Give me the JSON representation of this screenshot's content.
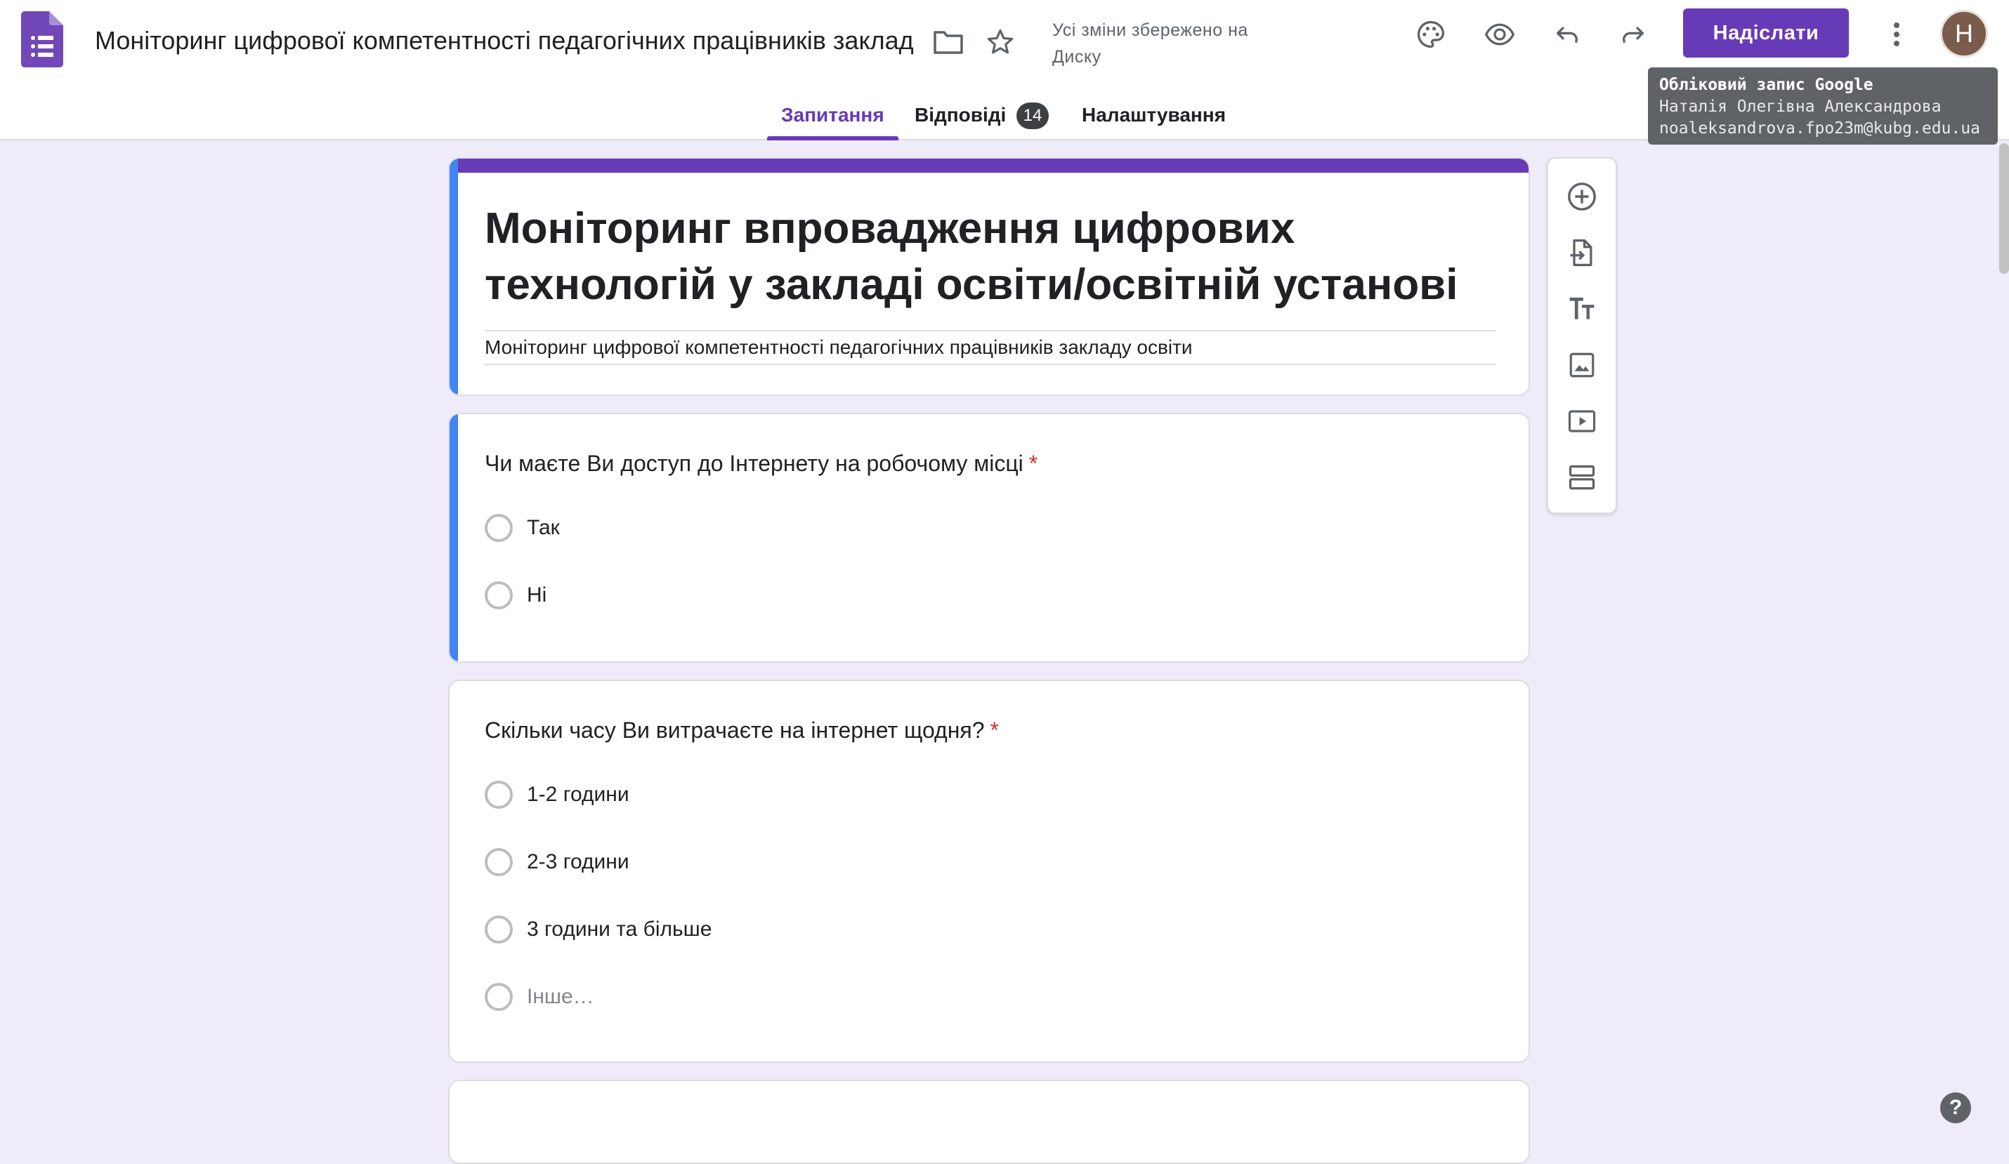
{
  "header": {
    "doc_title": "Моніторинг цифрової компетентності педагогічних працівників заклад",
    "save_status": "Усі зміни збережено на Диску",
    "send_label": "Надіслати",
    "avatar_letter": "Н",
    "icons": [
      "forms-logo-icon",
      "folder-icon",
      "star-icon",
      "palette-icon",
      "preview-eye-icon",
      "undo-icon",
      "redo-icon",
      "more-vert-icon"
    ],
    "accent_color": "#673ab7"
  },
  "tooltip": {
    "line1": "Обліковий запис Google",
    "line2": "Наталія Олегівна Александрова",
    "line3": "noaleksandrova.fpo23m@kubg.edu.ua"
  },
  "tabs": [
    {
      "label": "Запитання",
      "active": true
    },
    {
      "label": "Відповіді",
      "badge": "14"
    },
    {
      "label": "Налаштування"
    }
  ],
  "form": {
    "title": "Моніторинг впровадження цифрових технологій у закладі освіти/освітній установі",
    "description": "Моніторинг цифрової компетентності педагогічних працівників закладу освіти"
  },
  "questions": [
    {
      "text": "Чи маєте Ви доступ до Інтернету на робочому місці",
      "required": "*",
      "options": [
        "Так",
        "Ні"
      ]
    },
    {
      "text": "Скільки часу Ви витрачаєте на інтернет щодня?",
      "required": "*",
      "options": [
        "1-2 години",
        "2-3 години",
        "3 години та більше"
      ],
      "other_option": "Інше…"
    }
  ],
  "sidebar_tools": [
    "add-question-icon",
    "import-questions-icon",
    "add-title-icon",
    "add-image-icon",
    "add-video-icon",
    "add-section-icon"
  ],
  "help_label": "?"
}
